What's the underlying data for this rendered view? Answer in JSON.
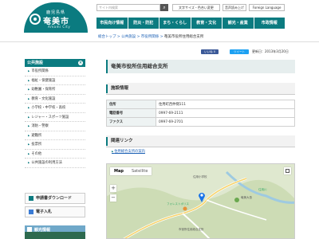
{
  "header": {
    "pref": "鹿児島県",
    "city": "奄美市",
    "city_en": "Amami City",
    "search_placeholder": "サイト内検索",
    "search_icon": "magnifier-icon",
    "buttons": [
      "文字サイズ・色合い変更",
      "音声読み上げ",
      "Foreign Language"
    ]
  },
  "gnav": [
    "市民向け情報",
    "防災・防犯",
    "まち・くらし",
    "教育・文化",
    "観光・産業",
    "市政情報"
  ],
  "breadcrumb": {
    "items": [
      "総合トップ",
      "公共施設",
      "市役所関係"
    ],
    "current": "奄美市役所住用総合支所"
  },
  "share": {
    "like_label": "いいね 0",
    "tweet_label": "ツイート"
  },
  "updated": "更新日：2013年3月20日",
  "sidebar": {
    "head": "公共施設",
    "items": [
      "市役所関係",
      "福祉・保健施設",
      "幼稚園・保育所",
      "教育・文化施設",
      "小学校・中学校・高校",
      "レジャー・スポーツ施設",
      "消防・警察",
      "避難所",
      "投票所",
      "その他",
      "公共施設の利用方法"
    ],
    "download": "申請書ダウンロード",
    "procedure": "電子入札",
    "banner": "観光情報"
  },
  "main": {
    "title": "奄美市役所住用総合支所",
    "section_info": "施設情報",
    "rows": [
      {
        "key": "住所",
        "value": "住用町西仲間111"
      },
      {
        "key": "電話番号",
        "value": "0997-69-2111"
      },
      {
        "key": "ファクス",
        "value": "0997-69-2701"
      }
    ],
    "section_links": "関連リンク",
    "link": "住用総合支所の案内"
  },
  "map": {
    "tab_map": "Map",
    "tab_satellite": "Satellite",
    "zoom_in": "+",
    "zoom_out": "−",
    "labels": [
      "住用小学校",
      "住用川",
      "奄美大島",
      "フォレストポリス",
      "市役所住用総合支所"
    ]
  },
  "colors": {
    "brand": "#0b7b80",
    "link": "#1a5fb4"
  }
}
